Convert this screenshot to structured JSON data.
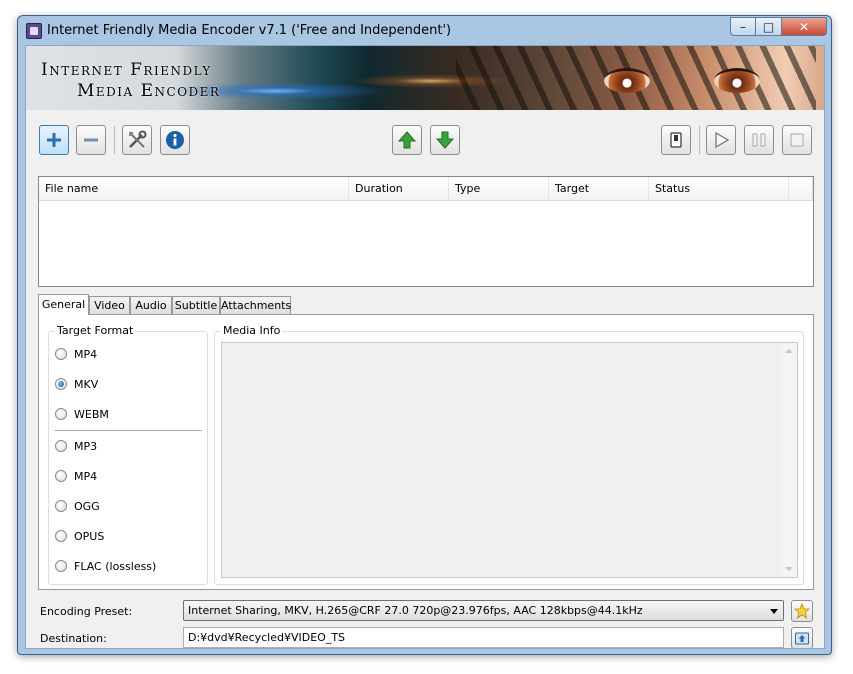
{
  "window": {
    "title": "Internet Friendly Media Encoder v7.1 ('Free and Independent')",
    "controls": {
      "minimize": "–",
      "maximize": "□",
      "close": "✕"
    }
  },
  "banner": {
    "line1": "Internet Friendly",
    "line2": "Media Encoder"
  },
  "toolbar": {
    "icons": {
      "add": "plus-icon",
      "remove": "minus-icon",
      "settings": "tools-icon",
      "info": "info-icon",
      "move_up": "arrow-up-icon",
      "move_down": "arrow-down-icon",
      "shutdown": "power-switch-icon",
      "play": "play-icon",
      "pause": "pause-icon",
      "stop": "stop-icon"
    }
  },
  "file_list": {
    "columns": [
      "File name",
      "Duration",
      "Type",
      "Target",
      "Status"
    ],
    "rows": []
  },
  "tabs": {
    "items": [
      "General",
      "Video",
      "Audio",
      "Subtitle",
      "Attachments"
    ],
    "active": "General"
  },
  "general": {
    "target_format": {
      "title": "Target Format",
      "video_options": [
        "MP4",
        "MKV",
        "WEBM"
      ],
      "audio_options": [
        "MP3",
        "MP4",
        "OGG",
        "OPUS",
        "FLAC (lossless)"
      ],
      "selected": "MKV"
    },
    "media_info": {
      "title": "Media Info",
      "text": ""
    }
  },
  "encoding_preset": {
    "label": "Encoding Preset:",
    "value": "Internet Sharing, MKV, H.265@CRF 27.0 720p@23.976fps, AAC 128kbps@44.1kHz",
    "button_icon": "star-icon"
  },
  "destination": {
    "label": "Destination:",
    "value": "D:¥dvd¥Recycled¥VIDEO_TS",
    "button_icon": "folder-browse-icon"
  },
  "colors": {
    "titlebar": "#a9c6e2",
    "client_bg": "#f0f0f0",
    "info_blue": "#1c5fa8",
    "arrow_green": "#3aa23a",
    "add_blue": "#2a6fb5"
  }
}
